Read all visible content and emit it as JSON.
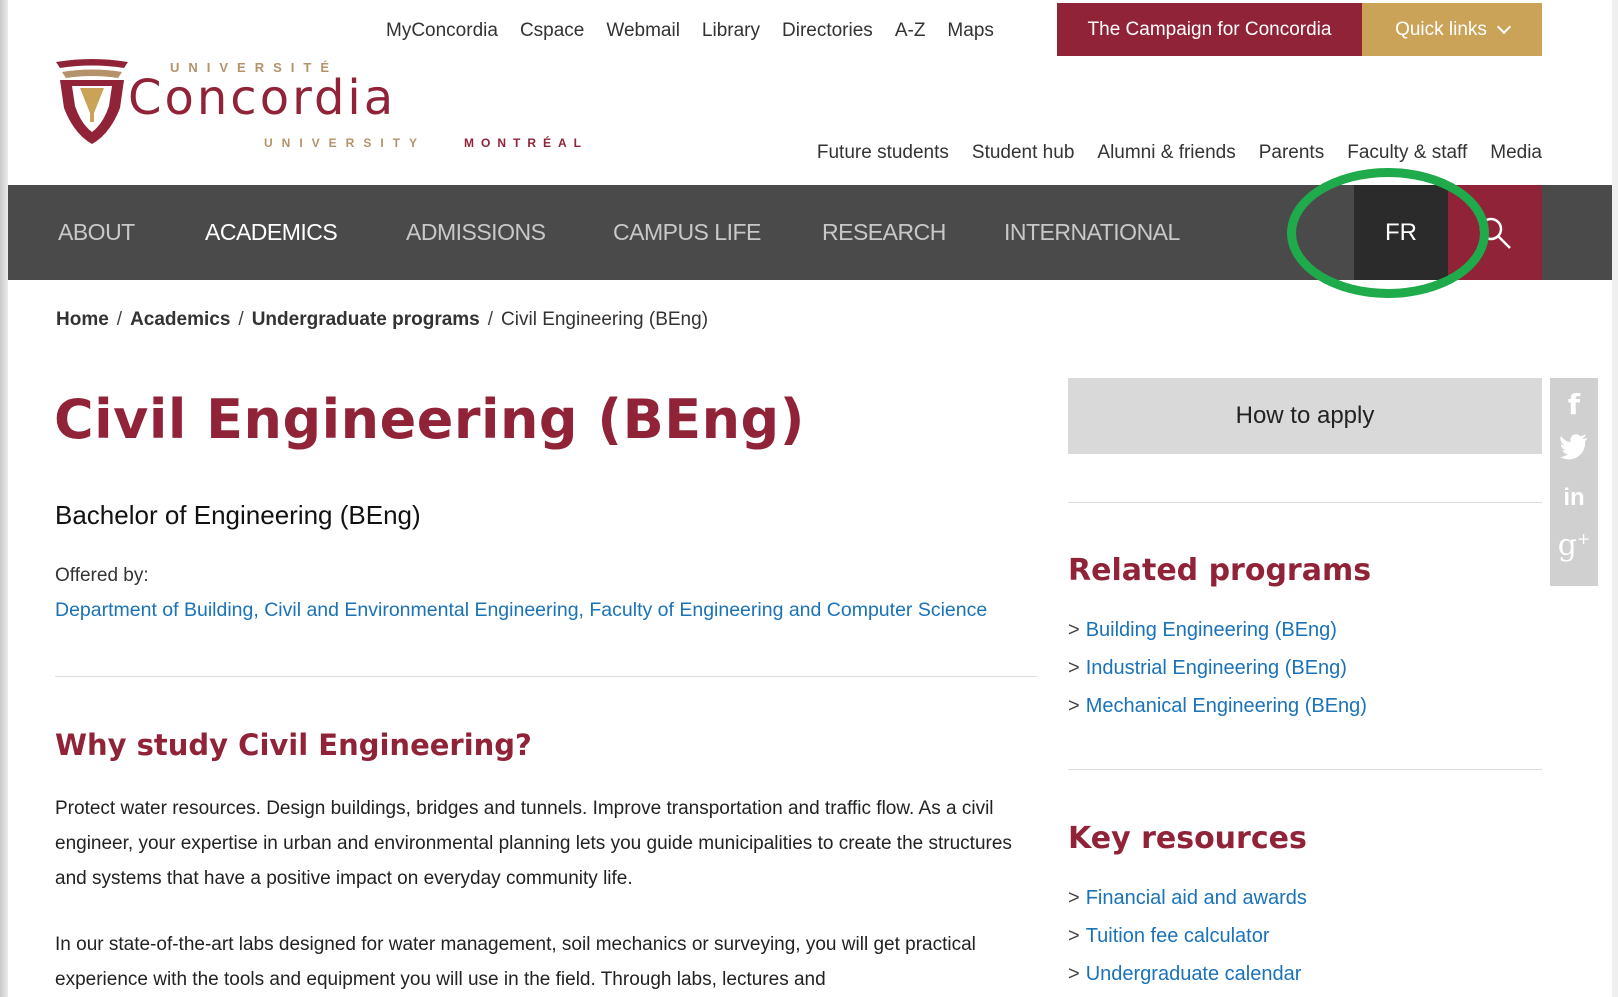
{
  "utility_links": [
    "MyConcordia",
    "Cspace",
    "Webmail",
    "Library",
    "Directories",
    "A-Z",
    "Maps"
  ],
  "campaign_button": "The Campaign for Concordia",
  "quick_links_button": "Quick links",
  "logo": {
    "university_fr": "UNIVERSITÉ",
    "wordmark": "Concordia",
    "university_en": "UNIVERSITY",
    "city": "MONTRÉAL"
  },
  "audience_links": [
    "Future students",
    "Student hub",
    "Alumni & friends",
    "Parents",
    "Faculty & staff",
    "Media"
  ],
  "main_nav": [
    "ABOUT",
    "ACADEMICS",
    "ADMISSIONS",
    "CAMPUS LIFE",
    "RESEARCH",
    "INTERNATIONAL"
  ],
  "main_nav_active": "ACADEMICS",
  "language_button": "FR",
  "breadcrumb": {
    "items": [
      "Home",
      "Academics",
      "Undergraduate programs"
    ],
    "current": "Civil Engineering (BEng)",
    "separator": "/"
  },
  "content": {
    "title": "Civil Engineering (BEng)",
    "subtitle": "Bachelor of Engineering (BEng)",
    "offered_by_label": "Offered by:",
    "department_link": "Department of Building, Civil and Environmental Engineering",
    "faculty_link": "Faculty of Engineering and Computer Science",
    "why_heading": "Why study Civil Engineering?",
    "paragraph1": "Protect water resources. Design buildings, bridges and tunnels. Improve transportation and traffic flow. As a civil engineer, your expertise in urban and environmental planning lets you guide municipalities to create the structures and systems that have a positive impact on everyday community life.",
    "paragraph2": "In our state-of-the-art labs designed for water management, soil mechanics or surveying, you will get practical experience with the tools and equipment you will use in the field. Through labs, lectures and"
  },
  "sidebar": {
    "apply_button": "How to apply",
    "related_heading": "Related programs",
    "related_programs": [
      "Building Engineering (BEng)",
      "Industrial Engineering (BEng)",
      "Mechanical Engineering (BEng)"
    ],
    "resources_heading": "Key resources",
    "resources": [
      "Financial aid and awards",
      "Tuition fee calculator",
      "Undergraduate calendar"
    ]
  },
  "social_icons": [
    "facebook-icon",
    "twitter-icon",
    "linkedin-icon",
    "google-plus-icon"
  ],
  "colors": {
    "brand_maroon": "#912338",
    "brand_gold": "#cba358",
    "nav_bg": "#4a4a4a",
    "link_blue": "#1a72b8",
    "highlight_green": "#1faa4b"
  }
}
